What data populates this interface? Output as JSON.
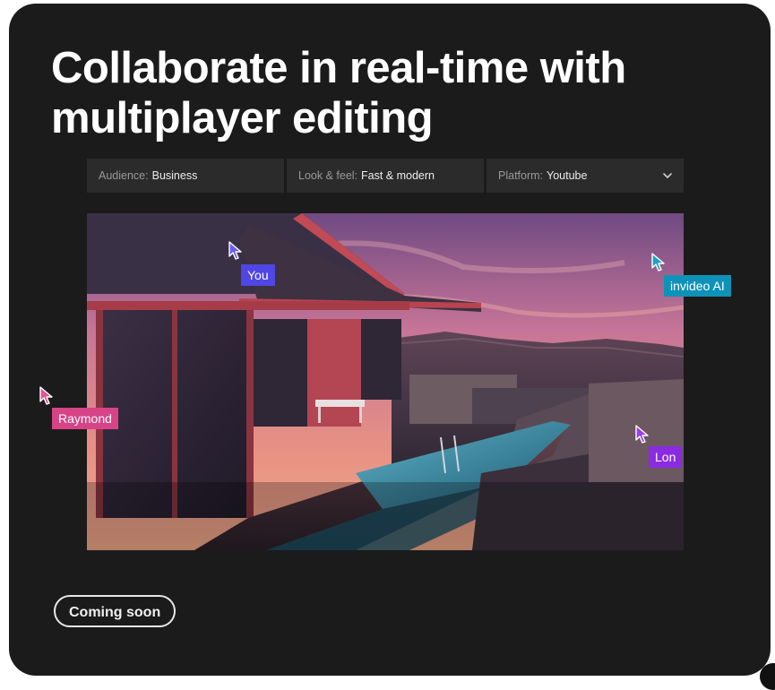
{
  "heading": "Collaborate in real-time with multiplayer editing",
  "filters": [
    {
      "label": "Audience:",
      "value": "Business"
    },
    {
      "label": "Look & feel:",
      "value": "Fast & modern"
    },
    {
      "label": "Platform:",
      "value": "Youtube"
    }
  ],
  "collaborators": [
    {
      "name": "You",
      "color": "#4f46e5"
    },
    {
      "name": "invideo AI",
      "color": "#0e92b8"
    },
    {
      "name": "Raymond",
      "color": "#d64487"
    },
    {
      "name": "Lon",
      "color": "#8a2be2"
    }
  ],
  "cta": {
    "label": "Coming soon"
  },
  "colors": {
    "card_bg": "#1b1b1b",
    "filter_bg": "#2b2b2b"
  }
}
